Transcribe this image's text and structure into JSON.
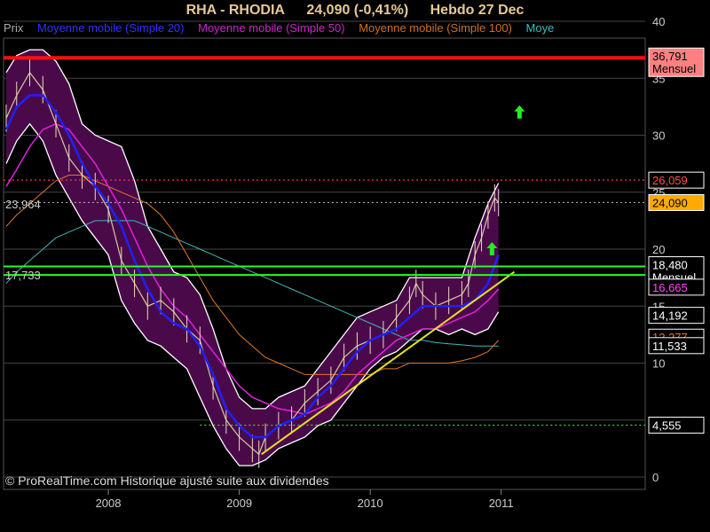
{
  "header": {
    "symbol": "RHA - RHODIA",
    "price": "24,090 (-0,41%)",
    "period": "Hebdo  27 Dec"
  },
  "legend": [
    {
      "label": "Prix",
      "color": "#aaaaaa"
    },
    {
      "label": "Moyenne mobile (Simple 20)",
      "color": "#3030ff"
    },
    {
      "label": "Moyenne mobile (Simple 50)",
      "color": "#d020d0"
    },
    {
      "label": "Moyenne mobile (Simple 100)",
      "color": "#d07020"
    },
    {
      "label": "Moye",
      "color": "#30c0c0"
    }
  ],
  "watermark": "© ProRealTime.com Historique ajusté suite aux dividendes",
  "colors": {
    "background": "#000000",
    "band_fill": "#4a0a4a",
    "band_edge": "#ffffff",
    "ma20": "#2020ff",
    "ma50": "#dd22dd",
    "ma100": "#e07828",
    "ma200": "#40b8b8",
    "resistance": "#ff1010",
    "support": "#22ff22",
    "trendline": "#e8e020",
    "dotted_red": "#ff3030",
    "dotted_green": "#44cc44",
    "arrow": "#22ee22"
  },
  "chart_data": {
    "type": "line",
    "title": "RHA - RHODIA",
    "xlabel": "",
    "ylabel": "",
    "x_ticks": [
      "2008",
      "2009",
      "2010",
      "2011"
    ],
    "y_ticks": [
      "0",
      "5",
      "10",
      "15",
      "20",
      "25",
      "30",
      "35",
      "40"
    ],
    "ylim": [
      0,
      40
    ],
    "xlim": [
      2007.2,
      2012.1
    ],
    "grid": true,
    "price_series": [
      [
        2007.22,
        31.5
      ],
      [
        2007.3,
        33.5
      ],
      [
        2007.4,
        35.5
      ],
      [
        2007.5,
        34.0
      ],
      [
        2007.6,
        31.0
      ],
      [
        2007.7,
        28.0
      ],
      [
        2007.8,
        26.5
      ],
      [
        2007.9,
        25.5
      ],
      [
        2008.0,
        23.5
      ],
      [
        2008.1,
        19.0
      ],
      [
        2008.2,
        17.0
      ],
      [
        2008.3,
        15.0
      ],
      [
        2008.4,
        15.5
      ],
      [
        2008.5,
        14.5
      ],
      [
        2008.6,
        13.0
      ],
      [
        2008.7,
        12.0
      ],
      [
        2008.8,
        8.0
      ],
      [
        2008.9,
        5.0
      ],
      [
        2009.0,
        3.5
      ],
      [
        2009.1,
        2.5
      ],
      [
        2009.15,
        2.0
      ],
      [
        2009.2,
        3.5
      ],
      [
        2009.3,
        4.5
      ],
      [
        2009.4,
        5.0
      ],
      [
        2009.5,
        6.5
      ],
      [
        2009.6,
        7.5
      ],
      [
        2009.7,
        8.5
      ],
      [
        2009.8,
        10.5
      ],
      [
        2009.9,
        11.5
      ],
      [
        2010.0,
        12.0
      ],
      [
        2010.1,
        12.5
      ],
      [
        2010.2,
        14.0
      ],
      [
        2010.3,
        15.5
      ],
      [
        2010.35,
        17.0
      ],
      [
        2010.4,
        16.0
      ],
      [
        2010.5,
        15.0
      ],
      [
        2010.6,
        15.5
      ],
      [
        2010.7,
        16.0
      ],
      [
        2010.75,
        17.0
      ],
      [
        2010.8,
        19.5
      ],
      [
        2010.85,
        21.0
      ],
      [
        2010.9,
        23.0
      ],
      [
        2010.95,
        24.5
      ],
      [
        2010.98,
        24.09
      ]
    ],
    "band_upper": [
      [
        2007.22,
        35.5
      ],
      [
        2007.3,
        37.0
      ],
      [
        2007.4,
        37.5
      ],
      [
        2007.5,
        37.5
      ],
      [
        2007.6,
        36.5
      ],
      [
        2007.7,
        34.5
      ],
      [
        2007.8,
        31.0
      ],
      [
        2007.9,
        30.0
      ],
      [
        2008.0,
        29.5
      ],
      [
        2008.1,
        29.0
      ],
      [
        2008.2,
        26.0
      ],
      [
        2008.3,
        22.0
      ],
      [
        2008.4,
        20.0
      ],
      [
        2008.5,
        18.0
      ],
      [
        2008.6,
        17.5
      ],
      [
        2008.7,
        16.0
      ],
      [
        2008.8,
        13.0
      ],
      [
        2008.9,
        9.5
      ],
      [
        2009.0,
        7.0
      ],
      [
        2009.1,
        6.0
      ],
      [
        2009.2,
        6.0
      ],
      [
        2009.3,
        7.0
      ],
      [
        2009.4,
        7.5
      ],
      [
        2009.5,
        8.0
      ],
      [
        2009.6,
        9.5
      ],
      [
        2009.7,
        11.0
      ],
      [
        2009.8,
        12.5
      ],
      [
        2009.9,
        14.0
      ],
      [
        2010.0,
        14.5
      ],
      [
        2010.1,
        15.0
      ],
      [
        2010.2,
        15.5
      ],
      [
        2010.3,
        17.5
      ],
      [
        2010.4,
        17.5
      ],
      [
        2010.5,
        17.5
      ],
      [
        2010.6,
        17.5
      ],
      [
        2010.7,
        17.5
      ],
      [
        2010.8,
        21.0
      ],
      [
        2010.9,
        24.0
      ],
      [
        2010.98,
        25.8
      ]
    ],
    "band_lower": [
      [
        2007.22,
        27.5
      ],
      [
        2007.3,
        29.5
      ],
      [
        2007.4,
        31.0
      ],
      [
        2007.5,
        29.5
      ],
      [
        2007.6,
        26.5
      ],
      [
        2007.7,
        24.5
      ],
      [
        2007.8,
        22.5
      ],
      [
        2007.9,
        21.0
      ],
      [
        2008.0,
        19.5
      ],
      [
        2008.1,
        15.5
      ],
      [
        2008.2,
        13.5
      ],
      [
        2008.3,
        12.0
      ],
      [
        2008.4,
        11.5
      ],
      [
        2008.5,
        10.5
      ],
      [
        2008.6,
        9.5
      ],
      [
        2008.7,
        7.0
      ],
      [
        2008.8,
        4.5
      ],
      [
        2008.9,
        2.5
      ],
      [
        2009.0,
        1.0
      ],
      [
        2009.1,
        1.0
      ],
      [
        2009.2,
        1.5
      ],
      [
        2009.3,
        2.5
      ],
      [
        2009.4,
        3.0
      ],
      [
        2009.5,
        3.5
      ],
      [
        2009.6,
        4.5
      ],
      [
        2009.7,
        5.0
      ],
      [
        2009.8,
        6.5
      ],
      [
        2009.9,
        8.0
      ],
      [
        2010.0,
        9.5
      ],
      [
        2010.1,
        10.5
      ],
      [
        2010.2,
        11.0
      ],
      [
        2010.3,
        12.0
      ],
      [
        2010.4,
        13.0
      ],
      [
        2010.5,
        13.0
      ],
      [
        2010.6,
        12.5
      ],
      [
        2010.7,
        13.0
      ],
      [
        2010.8,
        12.5
      ],
      [
        2010.9,
        13.0
      ],
      [
        2010.98,
        14.5
      ]
    ],
    "ma20": [
      [
        2007.22,
        30.5
      ],
      [
        2007.3,
        32.5
      ],
      [
        2007.4,
        33.5
      ],
      [
        2007.5,
        33.5
      ],
      [
        2007.6,
        32.0
      ],
      [
        2007.7,
        30.0
      ],
      [
        2007.8,
        27.5
      ],
      [
        2007.9,
        25.5
      ],
      [
        2008.0,
        24.0
      ],
      [
        2008.1,
        22.0
      ],
      [
        2008.2,
        19.0
      ],
      [
        2008.3,
        16.5
      ],
      [
        2008.4,
        14.5
      ],
      [
        2008.5,
        13.5
      ],
      [
        2008.6,
        13.0
      ],
      [
        2008.7,
        11.5
      ],
      [
        2008.8,
        9.0
      ],
      [
        2008.9,
        6.0
      ],
      [
        2009.0,
        4.5
      ],
      [
        2009.1,
        3.5
      ],
      [
        2009.2,
        3.5
      ],
      [
        2009.3,
        4.5
      ],
      [
        2009.4,
        5.0
      ],
      [
        2009.5,
        5.5
      ],
      [
        2009.6,
        7.0
      ],
      [
        2009.7,
        8.0
      ],
      [
        2009.8,
        9.5
      ],
      [
        2009.9,
        11.0
      ],
      [
        2010.0,
        12.0
      ],
      [
        2010.1,
        12.5
      ],
      [
        2010.2,
        13.0
      ],
      [
        2010.3,
        14.0
      ],
      [
        2010.4,
        15.0
      ],
      [
        2010.5,
        15.0
      ],
      [
        2010.6,
        15.0
      ],
      [
        2010.7,
        15.0
      ],
      [
        2010.8,
        15.5
      ],
      [
        2010.9,
        17.0
      ],
      [
        2010.98,
        19.5
      ]
    ],
    "ma50": [
      [
        2007.22,
        25.5
      ],
      [
        2007.3,
        27.0
      ],
      [
        2007.4,
        29.0
      ],
      [
        2007.5,
        30.5
      ],
      [
        2007.6,
        31.0
      ],
      [
        2007.7,
        30.5
      ],
      [
        2007.8,
        29.0
      ],
      [
        2007.9,
        27.5
      ],
      [
        2008.0,
        25.5
      ],
      [
        2008.1,
        23.5
      ],
      [
        2008.2,
        21.0
      ],
      [
        2008.3,
        18.5
      ],
      [
        2008.4,
        16.5
      ],
      [
        2008.5,
        15.0
      ],
      [
        2008.6,
        14.0
      ],
      [
        2008.7,
        12.5
      ],
      [
        2008.8,
        11.0
      ],
      [
        2008.9,
        9.5
      ],
      [
        2009.0,
        8.0
      ],
      [
        2009.1,
        7.0
      ],
      [
        2009.2,
        6.5
      ],
      [
        2009.3,
        6.0
      ],
      [
        2009.4,
        5.8
      ],
      [
        2009.5,
        5.5
      ],
      [
        2009.6,
        6.0
      ],
      [
        2009.7,
        6.5
      ],
      [
        2009.8,
        7.5
      ],
      [
        2009.9,
        9.0
      ],
      [
        2010.0,
        10.0
      ],
      [
        2010.1,
        11.0
      ],
      [
        2010.2,
        12.0
      ],
      [
        2010.3,
        12.5
      ],
      [
        2010.4,
        13.0
      ],
      [
        2010.5,
        13.0
      ],
      [
        2010.6,
        13.5
      ],
      [
        2010.7,
        14.0
      ],
      [
        2010.8,
        14.5
      ],
      [
        2010.9,
        15.5
      ],
      [
        2010.98,
        16.5
      ]
    ],
    "ma100": [
      [
        2007.22,
        22.0
      ],
      [
        2007.3,
        23.0
      ],
      [
        2007.4,
        24.0
      ],
      [
        2007.5,
        25.0
      ],
      [
        2007.6,
        26.0
      ],
      [
        2007.7,
        26.5
      ],
      [
        2007.8,
        26.5
      ],
      [
        2007.9,
        26.0
      ],
      [
        2008.0,
        25.5
      ],
      [
        2008.1,
        25.0
      ],
      [
        2008.2,
        24.5
      ],
      [
        2008.3,
        24.0
      ],
      [
        2008.4,
        23.0
      ],
      [
        2008.5,
        21.5
      ],
      [
        2008.6,
        19.5
      ],
      [
        2008.7,
        17.5
      ],
      [
        2008.8,
        15.5
      ],
      [
        2008.9,
        14.0
      ],
      [
        2009.0,
        12.5
      ],
      [
        2009.1,
        11.5
      ],
      [
        2009.2,
        10.5
      ],
      [
        2009.3,
        10.0
      ],
      [
        2009.4,
        9.5
      ],
      [
        2009.5,
        9.0
      ],
      [
        2009.6,
        9.0
      ],
      [
        2009.7,
        9.0
      ],
      [
        2009.8,
        9.0
      ],
      [
        2009.9,
        9.0
      ],
      [
        2010.0,
        9.0
      ],
      [
        2010.1,
        9.5
      ],
      [
        2010.2,
        9.5
      ],
      [
        2010.3,
        10.0
      ],
      [
        2010.4,
        10.0
      ],
      [
        2010.5,
        10.0
      ],
      [
        2010.6,
        10.0
      ],
      [
        2010.7,
        10.2
      ],
      [
        2010.8,
        10.5
      ],
      [
        2010.9,
        11.0
      ],
      [
        2010.98,
        12.0
      ]
    ],
    "ma200": [
      [
        2007.22,
        17.0
      ],
      [
        2007.3,
        18.0
      ],
      [
        2007.4,
        19.0
      ],
      [
        2007.5,
        20.0
      ],
      [
        2007.6,
        21.0
      ],
      [
        2007.7,
        21.5
      ],
      [
        2007.8,
        22.0
      ],
      [
        2007.9,
        22.5
      ],
      [
        2008.0,
        22.5
      ],
      [
        2008.1,
        22.5
      ],
      [
        2008.2,
        22.5
      ],
      [
        2008.3,
        22.0
      ],
      [
        2008.4,
        21.5
      ],
      [
        2008.5,
        21.0
      ],
      [
        2008.6,
        20.5
      ],
      [
        2008.7,
        20.0
      ],
      [
        2008.8,
        19.5
      ],
      [
        2008.9,
        19.0
      ],
      [
        2009.0,
        18.5
      ],
      [
        2009.1,
        18.0
      ],
      [
        2009.2,
        17.5
      ],
      [
        2009.3,
        17.0
      ],
      [
        2009.4,
        16.5
      ],
      [
        2009.5,
        16.0
      ],
      [
        2009.6,
        15.5
      ],
      [
        2009.7,
        15.0
      ],
      [
        2009.8,
        14.5
      ],
      [
        2009.9,
        14.0
      ],
      [
        2010.0,
        13.5
      ],
      [
        2010.1,
        13.0
      ],
      [
        2010.2,
        12.5
      ],
      [
        2010.3,
        12.0
      ],
      [
        2010.4,
        12.0
      ],
      [
        2010.5,
        11.8
      ],
      [
        2010.6,
        11.7
      ],
      [
        2010.7,
        11.6
      ],
      [
        2010.8,
        11.5
      ],
      [
        2010.9,
        11.5
      ],
      [
        2010.98,
        11.5
      ]
    ],
    "trendline": [
      [
        2009.17,
        2.0
      ],
      [
        2011.1,
        18.0
      ]
    ],
    "horizontal_lines": [
      {
        "name": "resistance-line",
        "value": 36.791,
        "style": "solid",
        "color": "#ff1010",
        "from": 2007.2
      },
      {
        "name": "dotted-red-line",
        "value": 26.059,
        "style": "dotted",
        "color": "#ff3030",
        "from": 2007.2
      },
      {
        "name": "dotted-price-line",
        "value": 24.09,
        "style": "dotted",
        "color": "#aaaaaa",
        "from": 2007.2
      },
      {
        "name": "support-line-upper",
        "value": 18.48,
        "style": "solid",
        "color": "#22ff22",
        "from": 2007.2
      },
      {
        "name": "support-line-lower",
        "value": 17.733,
        "style": "solid",
        "color": "#22ff22",
        "from": 2007.2
      },
      {
        "name": "dotted-green-line",
        "value": 4.555,
        "style": "dotted",
        "color": "#44cc44",
        "from": 2008.7
      }
    ],
    "left_labels": [
      {
        "text": "23,964",
        "value": 23.964
      },
      {
        "text": "17,733",
        "value": 17.733
      }
    ],
    "right_boxes": [
      {
        "text": "36,791",
        "value": 36.791,
        "sub": "Mensuel",
        "bg": "#ff8080",
        "fg": "#000000"
      },
      {
        "text": "26,059",
        "value": 26.059,
        "sub": "",
        "bg": "#000000",
        "fg": "#ff5050"
      },
      {
        "text": "24,090",
        "value": 24.09,
        "sub": "",
        "bg": "#ffaa00",
        "fg": "#000000"
      },
      {
        "text": "18,480",
        "value": 18.48,
        "sub": "Mensuel",
        "bg": "#000000",
        "fg": "#ffffff"
      },
      {
        "text": "16,665",
        "value": 16.665,
        "sub": "",
        "bg": "#000000",
        "fg": "#ff44ff"
      },
      {
        "text": "14,192",
        "value": 14.192,
        "sub": "",
        "bg": "#000000",
        "fg": "#ffffff"
      },
      {
        "text": "12,277",
        "value": 12.277,
        "sub": "",
        "bg": "#000000",
        "fg": "#e07828"
      },
      {
        "text": "11,533",
        "value": 11.533,
        "sub": "",
        "bg": "#000000",
        "fg": "#ffffff"
      },
      {
        "text": "4,555",
        "value": 4.555,
        "sub": "",
        "bg": "#000000",
        "fg": "#ffffff"
      }
    ],
    "arrows": [
      {
        "x": 2011.14,
        "y": 32.0
      },
      {
        "x": 2010.93,
        "y": 20.0
      }
    ]
  }
}
